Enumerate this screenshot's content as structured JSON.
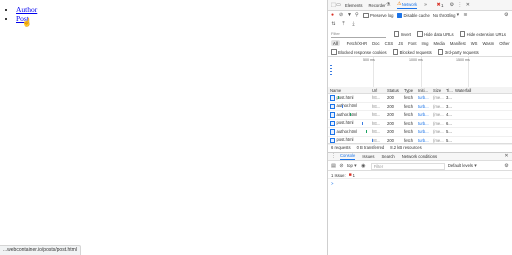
{
  "page": {
    "links": [
      "Author",
      "Post"
    ],
    "status_url": "...webcontainer.io/posts/post.html"
  },
  "devtools": {
    "tabs": [
      "Elements",
      "Recorder",
      "Network"
    ],
    "errors_badge": "1",
    "toolbar": {
      "preserve_log": "Preserve log",
      "disable_cache": "Disable cache",
      "throttling": "No throttling"
    },
    "filter": {
      "placeholder": "Filter",
      "invert": "Invert",
      "hide_data_urls": "Hide data URLs",
      "hide_extension_urls": "Hide extension URLs"
    },
    "types": [
      "All",
      "Fetch/XHR",
      "Doc",
      "CSS",
      "JS",
      "Font",
      "Img",
      "Media",
      "Manifest",
      "WS",
      "Wasm",
      "Other"
    ],
    "blocked": {
      "blocked_cookies": "Blocked response cookies",
      "blocked_requests": "Blocked requests",
      "third_party": "3rd-party requests"
    },
    "timeline_ticks": [
      "500 ms",
      "1000 ms",
      "1500 ms"
    ],
    "columns": {
      "name": "Name",
      "url": "Url",
      "status": "Status",
      "type": "Type",
      "initiator": "Initi...",
      "size": "Size",
      "time": "Ti...",
      "waterfall": "Waterfall"
    },
    "rows": [
      {
        "name": "post.html",
        "url": "htt...",
        "status": "200",
        "type": "fetch",
        "init": "turb...",
        "size": "(me...",
        "time": "3..."
      },
      {
        "name": "author.html",
        "url": "htt...",
        "status": "200",
        "type": "fetch",
        "init": "turb...",
        "size": "(me...",
        "time": "3..."
      },
      {
        "name": "author.html",
        "url": "htt...",
        "status": "200",
        "type": "fetch",
        "init": "turb...",
        "size": "(me...",
        "time": "4..."
      },
      {
        "name": "post.html",
        "url": "htt...",
        "status": "200",
        "type": "fetch",
        "init": "turb...",
        "size": "(me...",
        "time": "6..."
      },
      {
        "name": "author.html",
        "url": "htt...",
        "status": "200",
        "type": "fetch",
        "init": "turb...",
        "size": "(me...",
        "time": "5..."
      },
      {
        "name": "post.html",
        "url": "htt...",
        "status": "200",
        "type": "fetch",
        "init": "turb...",
        "size": "(me...",
        "time": "5..."
      }
    ],
    "summary": {
      "requests": "6 requests",
      "transferred": "0 B transferred",
      "resources": "8.2 kB resources"
    },
    "drawer_tabs": [
      "Console",
      "Issues",
      "Search",
      "Network conditions"
    ],
    "console": {
      "context": "top",
      "filter_placeholder": "Filter",
      "levels": "Default levels",
      "issues": "1 Issue:",
      "issues_count": "1",
      "prompt": ">"
    },
    "colors": {
      "accent": "#1a73e8",
      "error": "#d93025",
      "bar_green": "#1aa260"
    }
  }
}
